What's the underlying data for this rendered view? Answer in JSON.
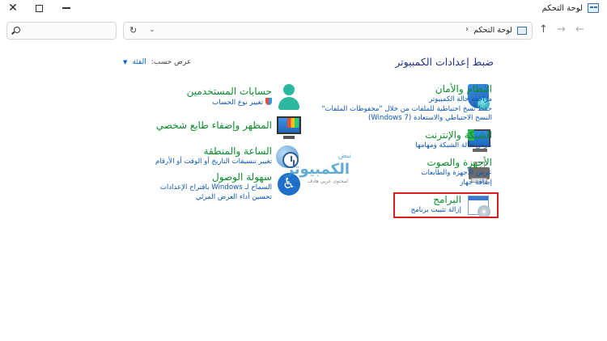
{
  "window": {
    "title": "لوحة التحكم",
    "controls": {
      "close": "✕",
      "maximize": "maximize",
      "minimize": "minimize"
    }
  },
  "address_bar": {
    "breadcrumb": "لوحة التحكم",
    "separator": "›",
    "refresh": "↻",
    "history": "⌄"
  },
  "search": {
    "placeholder": "",
    "value": ""
  },
  "nav": {
    "back": "←",
    "forward": "→",
    "up": "↑"
  },
  "main": {
    "title": "ضبط إعدادات الكمبيوتر",
    "view_by": {
      "label": "عرض حسب:",
      "value": "الفئة"
    }
  },
  "categories_right": [
    {
      "title": "النظام والأمان",
      "links": [
        "مراجعة حالة الكمبيوتر",
        "حفظ نُسخ احتياطية للملفات من خلال \"محفوظات الملفات\"",
        "النسخ الاحتياطي والاستعادة (Windows 7)"
      ],
      "icon": "shield-icon"
    },
    {
      "title": "الشبكة والإنترنت",
      "links": [
        "عرض حالة الشبكة ومهامها"
      ],
      "icon": "network-icon"
    },
    {
      "title": "الأجهزة والصوت",
      "links": [
        "عرض الأجهزة والطابعات",
        "إضافة جهاز"
      ],
      "icon": "printer-icon"
    },
    {
      "title": "البرامج",
      "links": [
        "إزالة تثبيت برنامج"
      ],
      "icon": "programs-icon"
    }
  ],
  "categories_left": [
    {
      "title": "حسابات المستخدمين",
      "links": [
        "تغيير نوع الحساب"
      ],
      "icon": "user-icon"
    },
    {
      "title": "المظهر وإضفاء طابع شخصي",
      "links": [],
      "icon": "appearance-icon"
    },
    {
      "title": "الساعة والمنطقة",
      "links": [
        "تغيير تنسيقات التاريخ أو الوقت أو الأرقام"
      ],
      "icon": "clock-icon"
    },
    {
      "title": "سهولة الوصول",
      "links": [
        "السماح لـ Windows باقتراح الإعدادات",
        "تحسين أداء العرض المرئي"
      ],
      "icon": "accessibility-icon"
    }
  ],
  "watermark": {
    "top": "نبض",
    "main": "الكمبيوتر",
    "sub": "لمحتوى عربي هادف"
  },
  "colors": {
    "category_title": "#0b8c2c",
    "link": "#0b56b8",
    "heading": "#1e3287",
    "highlight": "#d42020"
  }
}
